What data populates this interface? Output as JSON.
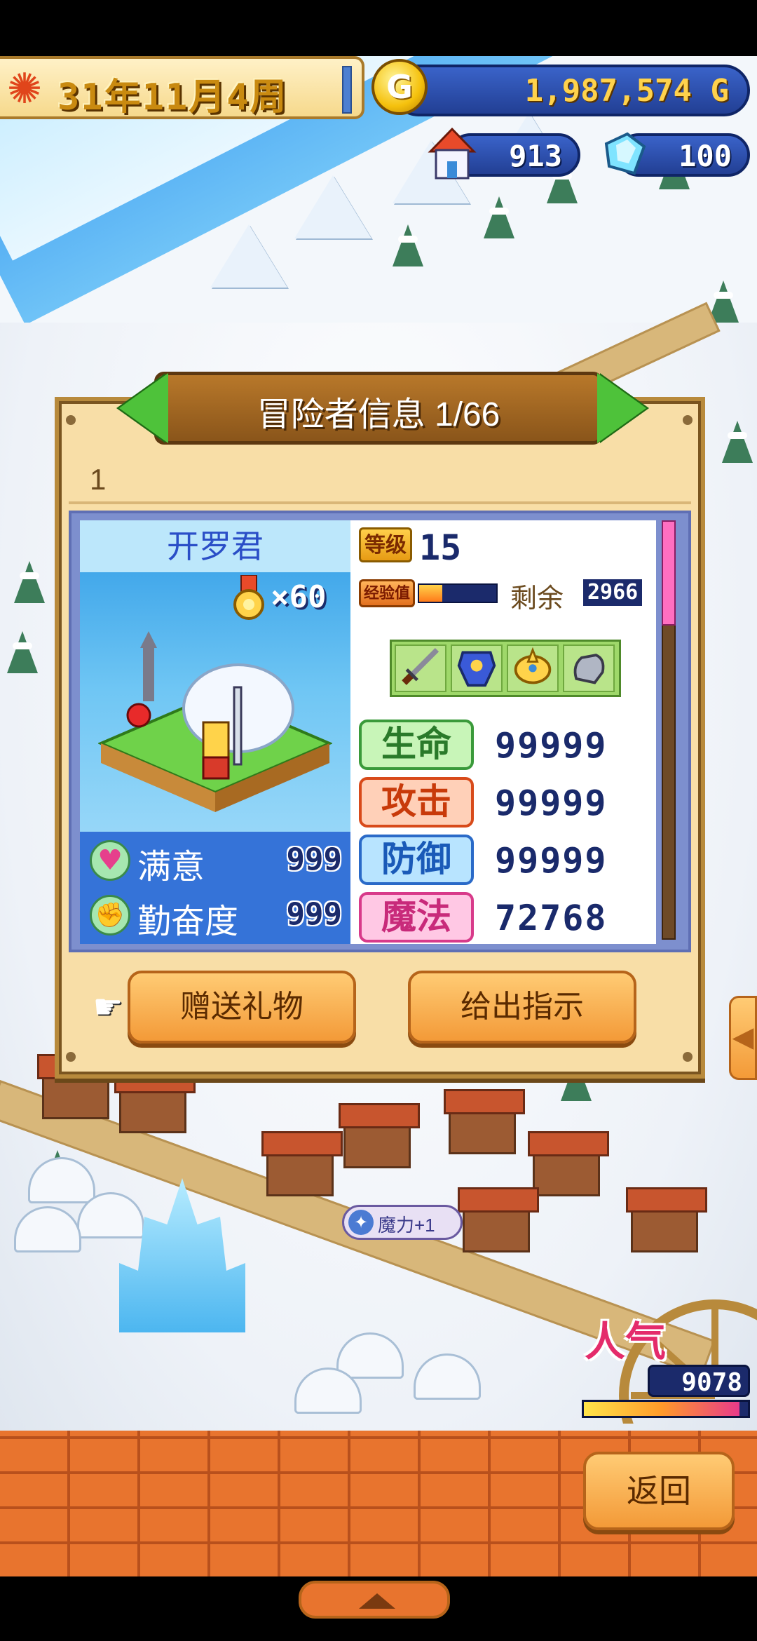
{
  "hud": {
    "date": "31年11月4周",
    "gold": "1,987,574 G",
    "houses": "913",
    "crystals": "100"
  },
  "panel": {
    "title": "冒险者信息 1/66",
    "number": "1"
  },
  "adventurer": {
    "name": "开罗君",
    "medals": "×60",
    "satisfaction_label": "满意",
    "satisfaction_value": "999",
    "diligence_label": "勤奋度",
    "diligence_value": "999",
    "level_label": "等级",
    "level": "15",
    "exp_label": "经验值",
    "exp_progress": 0.3,
    "remaining_label": "剩余",
    "remaining_value": "2966",
    "equipment": [
      "sword-icon",
      "armor-icon",
      "helmet-icon",
      "gauntlet-icon"
    ],
    "stats": [
      {
        "label": "生命",
        "value": "99999",
        "color": "#3a9a3a"
      },
      {
        "label": "攻击",
        "value": "99999",
        "color": "#d84a1a"
      },
      {
        "label": "防御",
        "value": "99999",
        "color": "#2a6ac8"
      },
      {
        "label": "魔法",
        "value": "72768",
        "color": "#d83a8a"
      }
    ]
  },
  "buttons": {
    "gift": "赠送礼物",
    "instruct": "给出指示",
    "back": "返回"
  },
  "bubble": {
    "text": "魔力+1"
  },
  "popularity": {
    "label": "人气",
    "value": "9078",
    "progress": 0.95
  }
}
